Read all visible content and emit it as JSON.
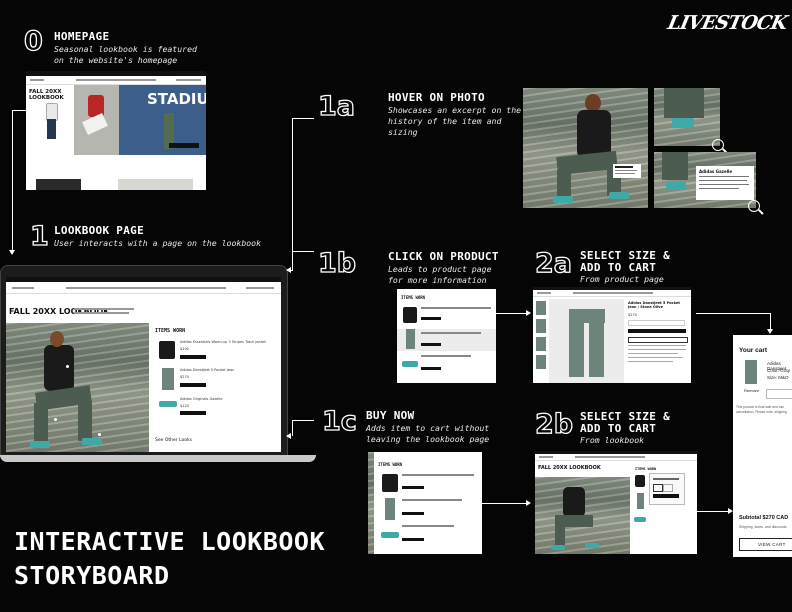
{
  "logo": "LIVESTOCK",
  "main_title": [
    "INTERACTIVE LOOKBOOK",
    "STORYBOARD"
  ],
  "steps": {
    "s0": {
      "num": "0",
      "title": "HOMEPAGE",
      "desc": [
        "Seasonal lookbook is featured",
        "on the website's homepage"
      ]
    },
    "s1": {
      "num": "1",
      "title": "LOOKBOOK PAGE",
      "desc": [
        "User interacts with a page on the lookbook"
      ]
    },
    "s1a": {
      "num": "1a",
      "title": "HOVER ON PHOTO",
      "desc": [
        "Showcases an excerpt on the",
        "history of the item and",
        "sizing"
      ]
    },
    "s1b": {
      "num": "1b",
      "title": "CLICK ON PRODUCT",
      "desc": [
        "Leads to product page",
        "for more information"
      ]
    },
    "s1c": {
      "num": "1c",
      "title": "BUY NOW",
      "desc": [
        "Adds item to cart without",
        "leaving the lookbook page"
      ]
    },
    "s2a": {
      "num": "2a",
      "title": [
        "SELECT SIZE &",
        "ADD TO CART"
      ],
      "desc": [
        "From product page"
      ]
    },
    "s2b": {
      "num": "2b",
      "title": [
        "SELECT SIZE &",
        "ADD TO CART"
      ],
      "desc": [
        "From lookbook"
      ]
    }
  },
  "screens": {
    "home_title": "FALL 20XX LOOKBOOK",
    "stadium_text": "STADIU",
    "lookbook_title": "FALL 20XX LOOKBOOK",
    "items_worn": "ITEMS WORN",
    "see_other": "See Other Looks",
    "product_names": [
      "Adidas Essentials Warm-up 3 Stripes Track Jacket",
      "Adidas Danstjeet 5 Pocket Jean",
      "Adidas Originals Gazelle"
    ],
    "prices": [
      "$100",
      "$270",
      "$120"
    ],
    "excerpt_title": "Adidas Gazelle",
    "product_page_title": "Adidas Danstjeet 5 Pocket Jean / Stone Olive"
  },
  "cart": {
    "title": "Your cart",
    "item": "Adidas Danstjeet",
    "color": "Color: Gray",
    "size": "Size: M&O",
    "remove": "Remove",
    "note_1": "This product is final sale and can",
    "note_2": "cancellation. Please note, shipping",
    "subtotal": "Subtotal $270 CAD",
    "shipping_note": "Shipping, taxes, and discounts",
    "view_cart": "VIEW CART"
  }
}
